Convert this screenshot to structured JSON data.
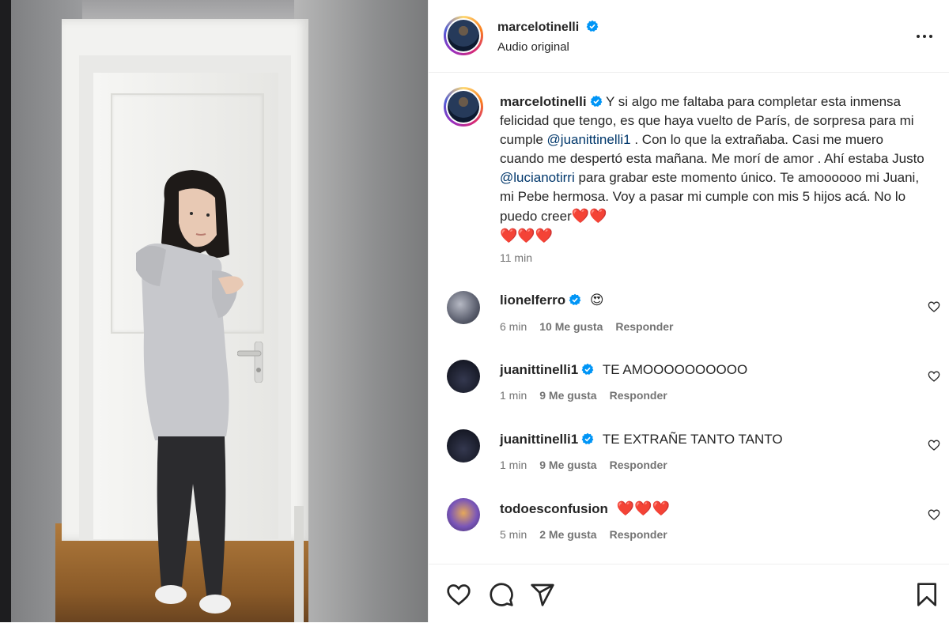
{
  "post": {
    "author": "marcelotinelli",
    "audio_label": "Audio original",
    "more_icon": "more-horizontal-icon"
  },
  "caption": {
    "username": "marcelotinelli",
    "text_part1": "Y si algo me faltaba para completar esta inmensa felicidad que tengo, es que haya vuelto de París, de sorpresa para mi cumple ",
    "mention1": "@juanittinelli1",
    "text_part2": " . Con lo que la extrañaba. Casi me muero cuando me despertó esta mañana. Me morí de amor . Ahí estaba Justo ",
    "mention2": "@lucianotirri",
    "text_part3": " para grabar este momento único. Te amoooooo mi Juani, mi Pebe hermosa. Voy a pasar mi cumple con mis 5 hijos acá. No lo puedo creer",
    "hearts_inline": "❤️❤️",
    "hearts_next": "❤️❤️❤️",
    "time": "11 min"
  },
  "comments": [
    {
      "username": "lionelferro",
      "text": "😍",
      "time": "6 min",
      "likes": "10 Me gusta",
      "reply": "Responder"
    },
    {
      "username": "juanittinelli1",
      "text": "TE AMOOOOOOOOOO",
      "time": "1 min",
      "likes": "9 Me gusta",
      "reply": "Responder"
    },
    {
      "username": "juanittinelli1",
      "text": "TE EXTRAÑE TANTO TANTO",
      "time": "1 min",
      "likes": "9 Me gusta",
      "reply": "Responder"
    },
    {
      "username": "todoesconfusion",
      "text": "❤️❤️❤️",
      "time": "5 min",
      "likes": "2 Me gusta",
      "reply": "Responder"
    }
  ],
  "actions": {
    "like_icon": "heart-icon",
    "comment_icon": "comment-icon",
    "share_icon": "send-icon",
    "save_icon": "bookmark-icon"
  },
  "colors": {
    "verified": "#0095f6",
    "mention": "#00376b",
    "secondary_text": "#737373"
  }
}
